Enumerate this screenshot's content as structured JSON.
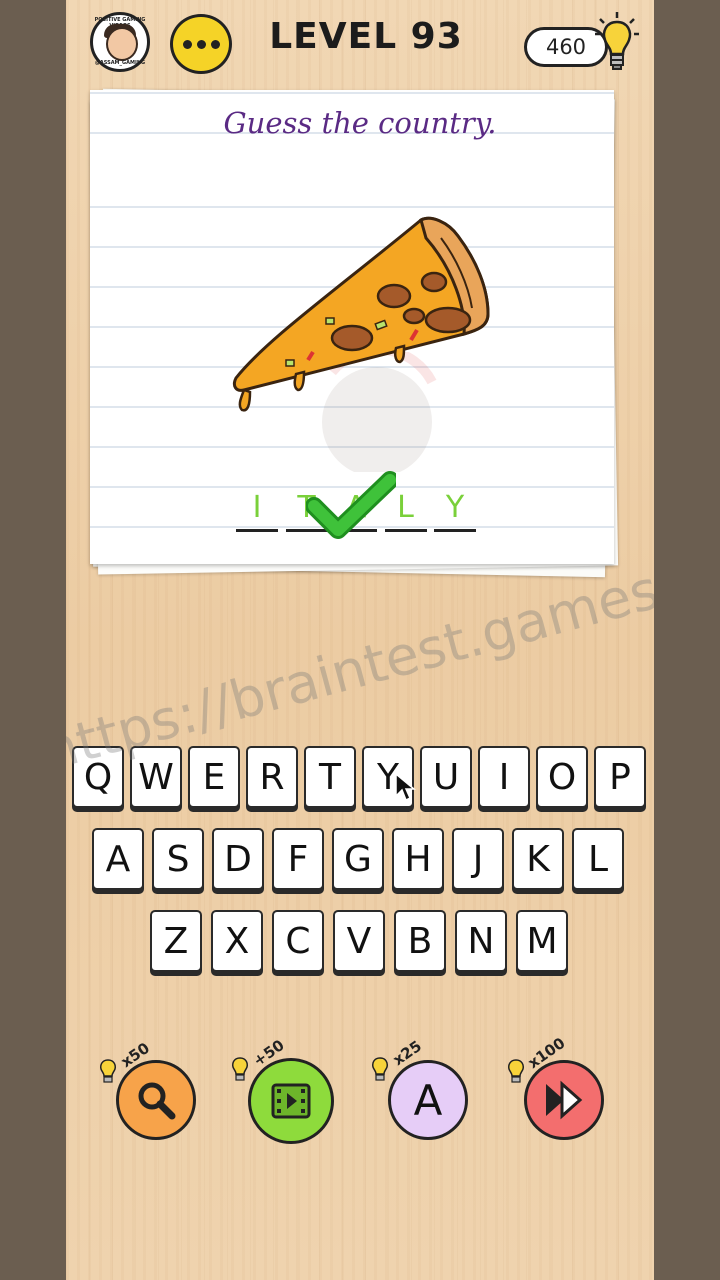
{
  "header": {
    "avatar_top_text": "POSITIVE GAMING VIDEOS",
    "avatar_bottom_text": "@ASSAM_GAMING",
    "level_title": "LEVEL 93",
    "hint_count": "460"
  },
  "puzzle": {
    "question": "Guess the country.",
    "answer_letters": [
      "I",
      "T",
      "A",
      "L",
      "Y"
    ]
  },
  "keyboard": {
    "row1": [
      "Q",
      "W",
      "E",
      "R",
      "T",
      "Y",
      "U",
      "I",
      "O",
      "P"
    ],
    "row2": [
      "A",
      "S",
      "D",
      "F",
      "G",
      "H",
      "J",
      "K",
      "L"
    ],
    "row3": [
      "Z",
      "X",
      "C",
      "V",
      "B",
      "N",
      "M"
    ]
  },
  "watermark_text": "https://braintest.games",
  "powerups": [
    {
      "name": "search",
      "cost": "x50",
      "color": "#f7a34a"
    },
    {
      "name": "video",
      "cost": "+50",
      "color": "#8edb3c"
    },
    {
      "name": "letter",
      "cost": "x25",
      "color": "#d8b2f0",
      "label": "A"
    },
    {
      "name": "skip",
      "cost": "x100",
      "color": "#f36e6e"
    }
  ],
  "colors": {
    "question_text": "#5a2a84",
    "correct_green": "#7ad03a",
    "menu_yellow": "#f5d327"
  }
}
